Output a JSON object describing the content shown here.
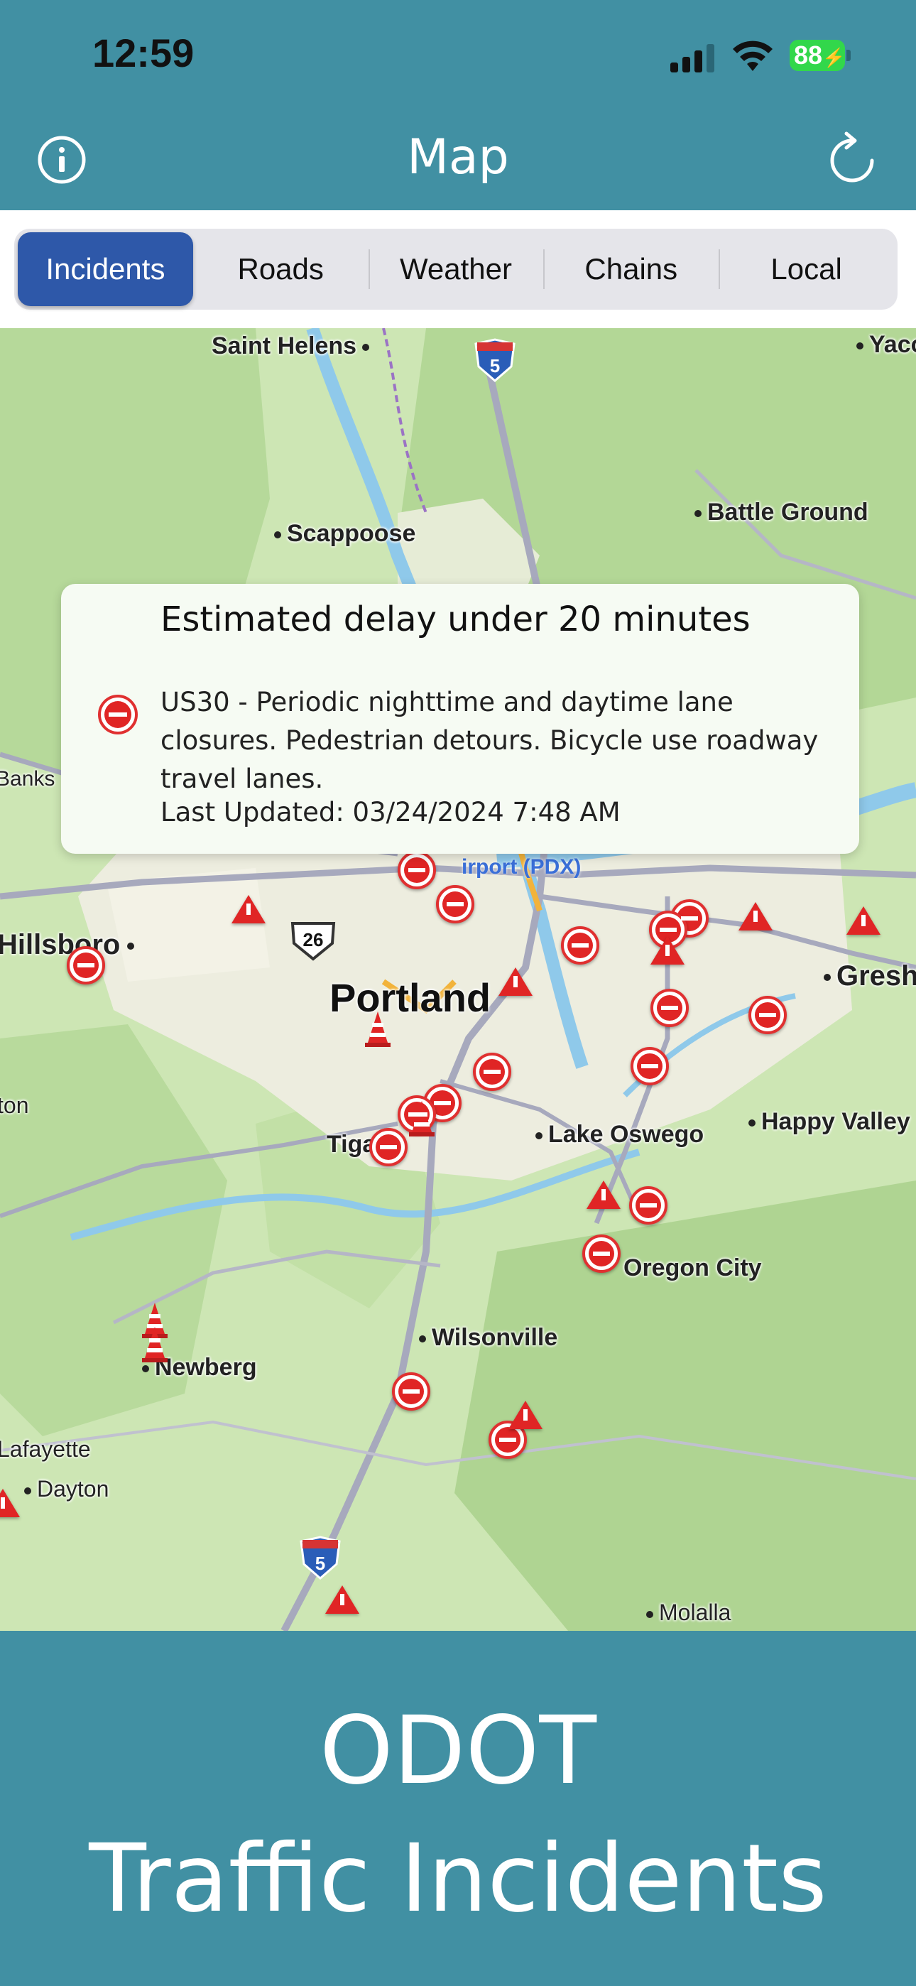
{
  "status_bar": {
    "time": "12:59",
    "battery": "88"
  },
  "nav": {
    "title": "Map",
    "info_icon": "info-icon",
    "refresh_icon": "refresh-icon"
  },
  "tabs": [
    {
      "label": "Incidents",
      "active": true
    },
    {
      "label": "Roads",
      "active": false
    },
    {
      "label": "Weather",
      "active": false
    },
    {
      "label": "Chains",
      "active": false
    },
    {
      "label": "Local",
      "active": false
    }
  ],
  "map": {
    "places": {
      "saint_helens": "Saint Helens",
      "scappoose": "Scappoose",
      "battle_ground": "Battle Ground",
      "yacolt": "Yaco",
      "banks": "Banks",
      "hillsboro": "Hillsboro",
      "portland": "Portland",
      "gresham": "Gresh",
      "tigard": "Tiga",
      "lake_oswego": "Lake Oswego",
      "happy_valley": "Happy Valley",
      "oregon_city": "Oregon City",
      "wilsonville": "Wilsonville",
      "newberg": "Newberg",
      "lafayette": "Lafayette",
      "dayton": "Dayton",
      "molalla": "Molalla",
      "forest_grove": "ton",
      "airport": "irport (PDX)"
    },
    "shields": {
      "i5_top": "5",
      "i5_bottom": "5",
      "us26": "26"
    }
  },
  "callout": {
    "title": "Estimated delay under 20 minutes",
    "description": "US30 - Periodic nighttime and daytime lane closures. Pedestrian detours. Bicycle use roadway travel lanes.",
    "updated": "Last Updated: 03/24/2024 7:48 AM",
    "icon": "road-closed-icon"
  },
  "footer": {
    "line1": "ODOT",
    "line2": "Traffic Incidents"
  },
  "colors": {
    "brand": "#4190a3",
    "tab_active": "#2e58a9",
    "incident_red": "#e02525"
  }
}
